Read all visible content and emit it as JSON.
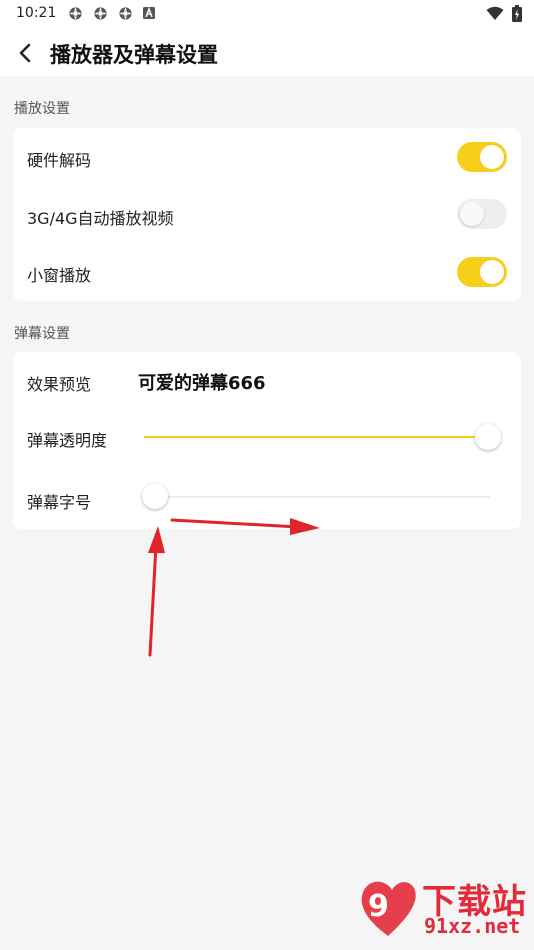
{
  "status_bar": {
    "time": "10:21",
    "icons": [
      "sync-icon",
      "sync-icon",
      "sync-icon",
      "a-badge-icon"
    ],
    "right_icons": [
      "wifi-icon",
      "battery-icon"
    ]
  },
  "header": {
    "title": "播放器及弹幕设置",
    "back_icon": "chevron-left-icon"
  },
  "playback": {
    "section_title": "播放设置",
    "items": [
      {
        "label": "硬件解码",
        "enabled": true
      },
      {
        "label": "3G/4G自动播放视频",
        "enabled": false
      },
      {
        "label": "小窗播放",
        "enabled": true
      }
    ]
  },
  "danmaku": {
    "section_title": "弹幕设置",
    "preview_label": "效果预览",
    "preview_text": "可爱的弹幕666",
    "opacity_label": "弹幕透明度",
    "opacity_value": 1.0,
    "fontsize_label": "弹幕字号",
    "fontsize_value": 0.0
  },
  "annotation": {
    "color": "#e0242b"
  },
  "watermark": {
    "line1": "下载站",
    "line2": "91xz.net",
    "color": "#e32a3a"
  },
  "colors": {
    "accent": "#f7cf1b",
    "background": "#f5f5f5",
    "card": "#ffffff"
  }
}
